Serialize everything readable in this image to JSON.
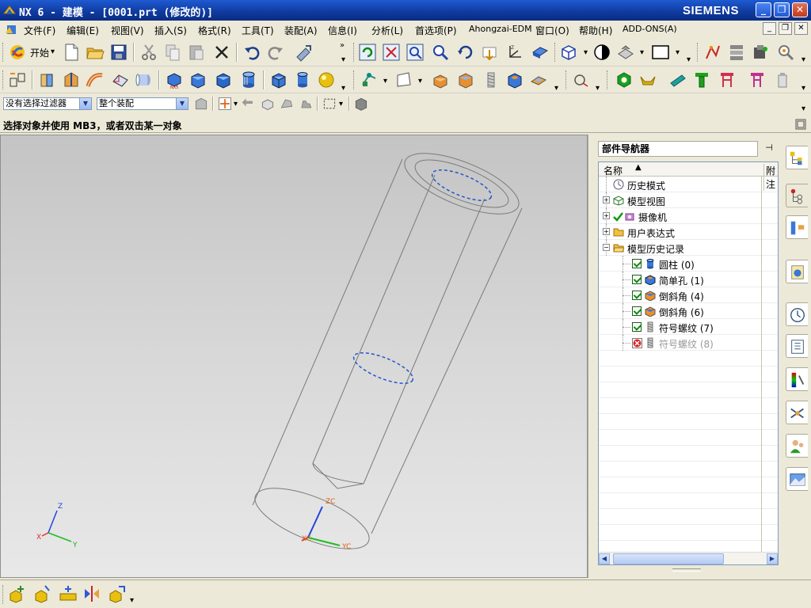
{
  "window": {
    "title": "NX 6 - 建模 - [0001.prt (修改的)]",
    "brand": "SIEMENS",
    "buttons": [
      "minimize",
      "restore",
      "close"
    ]
  },
  "menubar": {
    "items": [
      "文件(F)",
      "编辑(E)",
      "视图(V)",
      "插入(S)",
      "格式(R)",
      "工具(T)",
      "装配(A)",
      "信息(I)",
      "分析(L)",
      "首选项(P)",
      "Ahongzai-EDM",
      "窗口(O)",
      "帮助(H)",
      "ADD-ONS(A)"
    ]
  },
  "toolbar1": {
    "start_label": "开始",
    "icons": [
      "new-icon",
      "open-icon",
      "save-icon",
      "cut-icon",
      "copy-icon",
      "paste-icon",
      "delete-icon",
      "undo-icon",
      "redo-icon",
      "repeat-command-icon",
      "refresh-icon",
      "fit-icon",
      "zoom-icon",
      "zoom-in-out-icon",
      "rotate-icon",
      "pan-icon",
      "wcs-icon",
      "orient-view-icon",
      "render-style-icon",
      "shaded-icon",
      "section-icon",
      "background-icon",
      "analysis-icon",
      "measure-icon",
      "edit-icon",
      "snapshot-icon"
    ]
  },
  "toolbar2": {
    "icons": [
      "sketch-icon",
      "extrude-icon",
      "revolve-icon",
      "sweep-icon",
      "tube-icon",
      "cylinder-small-icon",
      "nx5-block-icon",
      "block-icon",
      "block2-icon",
      "cylinder-icon",
      "box-icon",
      "cylinder2-icon",
      "sphere-icon",
      "point-icon",
      "plane-icon",
      "boolean-icon",
      "chamfer-icon",
      "thread-icon",
      "hole-icon",
      "pad-icon",
      "curve-icon",
      "hex-nut-icon",
      "clip-icon",
      "bolt-icon",
      "tee-icon",
      "stand-icon",
      "post-icon"
    ]
  },
  "filterbar": {
    "type_filter": "没有选择过滤器",
    "scope": "整个装配"
  },
  "cue": {
    "text": "选择对象并使用 MB3，或者双击某一对象"
  },
  "viewport": {
    "axes": {
      "x": "X",
      "y": "Y",
      "z": "Z",
      "xc": "XC",
      "yc": "YC",
      "zc": "ZC"
    }
  },
  "navigator": {
    "title": "部件导航器",
    "col_name": "名称",
    "col_attached": "附注",
    "nodes": [
      {
        "label": "历史模式",
        "indent": 0,
        "expander": false,
        "checked": false,
        "icon": "clock-icon"
      },
      {
        "label": "模型视图",
        "indent": 0,
        "expander": true,
        "checked": false,
        "icon": "model-view-icon"
      },
      {
        "label": "摄像机",
        "indent": 0,
        "expander": true,
        "checked": true,
        "icon": "camera-icon"
      },
      {
        "label": "用户表达式",
        "indent": 0,
        "expander": true,
        "checked": false,
        "icon": "folder-icon"
      },
      {
        "label": "模型历史记录",
        "indent": 0,
        "expander": true,
        "expanded": true,
        "checked": false,
        "icon": "folder-open-icon"
      },
      {
        "label": "圆柱 (0)",
        "indent": 1,
        "checked": true,
        "icon": "cylinder-feature-icon"
      },
      {
        "label": "简单孔 (1)",
        "indent": 1,
        "checked": true,
        "icon": "hole-feature-icon"
      },
      {
        "label": "倒斜角 (4)",
        "indent": 1,
        "checked": true,
        "icon": "chamfer-feature-icon"
      },
      {
        "label": "倒斜角 (6)",
        "indent": 1,
        "checked": true,
        "icon": "chamfer-feature-icon"
      },
      {
        "label": "符号螺纹 (7)",
        "indent": 1,
        "checked": true,
        "icon": "thread-feature-icon"
      },
      {
        "label": "符号螺纹 (8)",
        "indent": 1,
        "checked": false,
        "suppressed": true,
        "icon": "thread-feature-icon"
      }
    ]
  },
  "resource_bar": {
    "tabs": [
      "assembly-navigator-icon",
      "part-navigator-icon",
      "constraint-navigator-icon",
      "web-browser-icon",
      "history-icon",
      "reuse-library-icon",
      "palette-icon",
      "manufacturing-icon",
      "roles-icon",
      "system-scenes-icon"
    ]
  },
  "bottombar": {
    "icons": [
      "add-component-icon",
      "new-component-icon",
      "new-parent-icon",
      "mirror-assembly-icon",
      "explode-icon"
    ]
  }
}
